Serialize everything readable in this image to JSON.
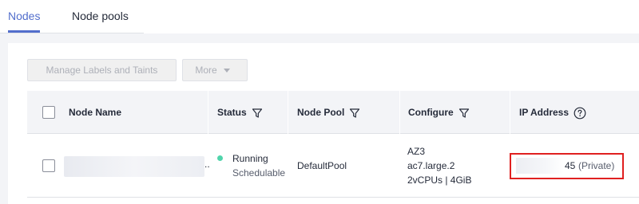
{
  "tabs": [
    {
      "label": "Nodes",
      "active": true
    },
    {
      "label": "Node pools",
      "active": false
    }
  ],
  "toolbar": {
    "manage_labels_label": "Manage Labels and Taints",
    "more_label": "More"
  },
  "table": {
    "columns": {
      "node_name": "Node Name",
      "status": "Status",
      "node_pool": "Node Pool",
      "configure": "Configure",
      "ip_address": "IP Address"
    },
    "rows": [
      {
        "node_name_suffix": "..",
        "status": "Running",
        "status_sub": "Schedulable",
        "node_pool": "DefaultPool",
        "configure": [
          "AZ3",
          "ac7.large.2",
          "2vCPUs | 4GiB"
        ],
        "ip_suffix": "45",
        "ip_type": "(Private)"
      }
    ]
  },
  "colors": {
    "accent": "#526ecc",
    "status_running": "#50d4ab",
    "highlight": "#e02020"
  }
}
